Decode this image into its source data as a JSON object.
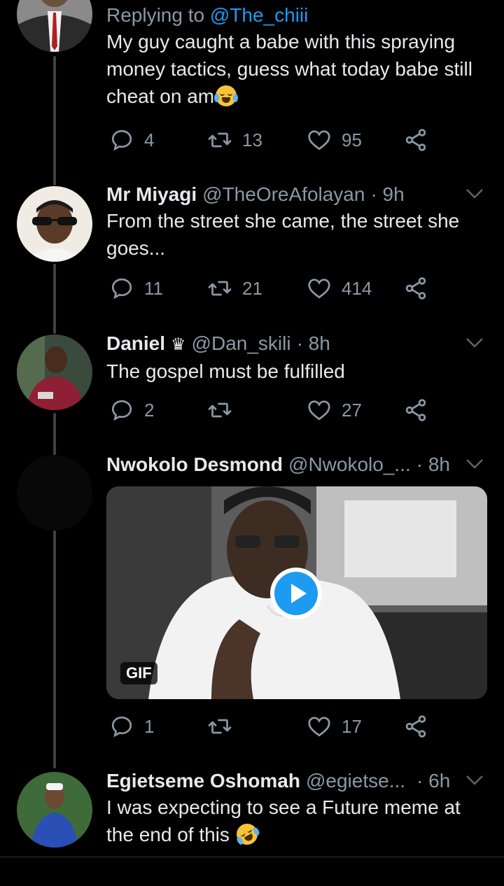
{
  "colors": {
    "background": "#000000",
    "accent": "#1d9bf0",
    "secondary_text": "#8b98a5",
    "thread_line": "#3d4248"
  },
  "tweets": [
    {
      "replying_prefix": "Replying to ",
      "replying_to": "@The_chiii",
      "text": "My guy caught a babe  with this spraying money tactics, guess what today babe still cheat on am",
      "emoji": "loudly-crying-face",
      "replies": "4",
      "retweets": "13",
      "likes": "95"
    },
    {
      "name": "Mr Miyagi",
      "handle": "@TheOreAfolayan",
      "time": "· 9h",
      "text": "From the street she came, the street she goes...",
      "replies": "11",
      "retweets": "21",
      "likes": "414"
    },
    {
      "name": "Daniel",
      "badge": "♛",
      "handle": "@Dan_skili",
      "time": "· 8h",
      "text": "The gospel must be fulfilled",
      "replies": "2",
      "retweets": "",
      "likes": "27"
    },
    {
      "name": "Nwokolo Desmond",
      "handle": "@Nwokolo_...",
      "time": "· 8h",
      "media_badge": "GIF",
      "replies": "1",
      "retweets": "",
      "likes": "17"
    },
    {
      "name": "Egietseme Oshomah",
      "handle": "@egietse...",
      "time": "· 6h",
      "text": "I was expecting to see a Future meme at the end of this",
      "emoji": "rolling-on-floor-laughing"
    }
  ],
  "icons": {
    "reply": "reply-icon",
    "retweet": "retweet-icon",
    "like": "heart-icon",
    "share": "share-icon",
    "more": "chevron-down-icon",
    "play": "play-icon"
  }
}
